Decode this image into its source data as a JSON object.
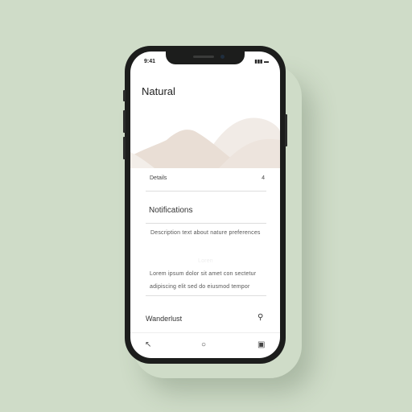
{
  "status": {
    "time": "9:41",
    "indicators": "▮▮▮ ▬"
  },
  "header": {
    "title": "Natural"
  },
  "list": {
    "row1_label": "Details",
    "row1_value": "4",
    "section_title": "Notifications",
    "line1": "Description text about nature preferences",
    "faint": "Loren",
    "para1": "Lorem ipsum dolor sit amet con sectetur",
    "para2": "adipiscing elit sed do eiusmod tempor",
    "footer_label": "Wanderlust"
  },
  "nav": {
    "items": [
      "back-icon",
      "home-icon",
      "tabs-icon"
    ]
  },
  "colors": {
    "background": "#cfdcc8",
    "hill": "#e8ddd4"
  }
}
